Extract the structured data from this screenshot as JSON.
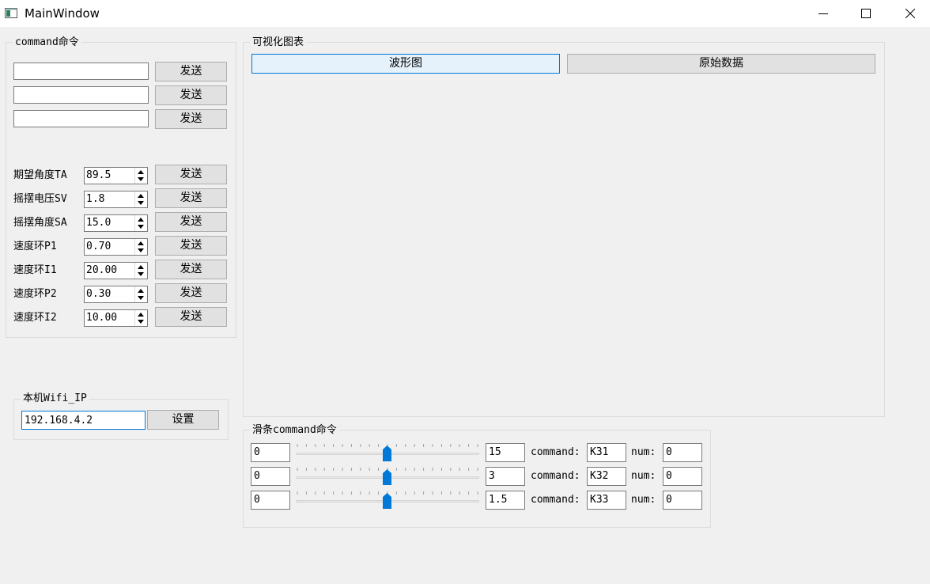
{
  "window": {
    "title": "MainWindow"
  },
  "command_group": {
    "title": "command命令",
    "rows": [
      {
        "value": "",
        "button": "发送"
      },
      {
        "value": "",
        "button": "发送"
      },
      {
        "value": "",
        "button": "发送"
      }
    ]
  },
  "params": [
    {
      "label": "期望角度TA",
      "value": "89.5",
      "button": "发送"
    },
    {
      "label": "摇摆电压SV",
      "value": "1.8",
      "button": "发送"
    },
    {
      "label": "摇摆角度SA",
      "value": "15.0",
      "button": "发送"
    },
    {
      "label": "速度环P1",
      "value": "0.70",
      "button": "发送"
    },
    {
      "label": "速度环I1",
      "value": "20.00",
      "button": "发送"
    },
    {
      "label": "速度环P2",
      "value": "0.30",
      "button": "发送"
    },
    {
      "label": "速度环I2",
      "value": "10.00",
      "button": "发送"
    }
  ],
  "wifi_group": {
    "title": "本机Wifi_IP",
    "ip": "192.168.4.2",
    "set_button": "设置"
  },
  "chart_group": {
    "title": "可视化图表",
    "tabs": [
      "波形图",
      "原始数据"
    ],
    "active_tab": 0
  },
  "slider_group": {
    "title": "滑条command命令",
    "command_label": "command:",
    "num_label": "num:",
    "rows": [
      {
        "min": "0",
        "max": "15",
        "position": 0.5,
        "command": "K31",
        "num": "0"
      },
      {
        "min": "0",
        "max": "3",
        "position": 0.5,
        "command": "K32",
        "num": "0"
      },
      {
        "min": "0",
        "max": "1.5",
        "position": 0.5,
        "command": "K33",
        "num": "0"
      }
    ]
  },
  "colors": {
    "accent": "#0078d7",
    "background": "#f0f0f0",
    "titlebar": "#ffffff"
  }
}
